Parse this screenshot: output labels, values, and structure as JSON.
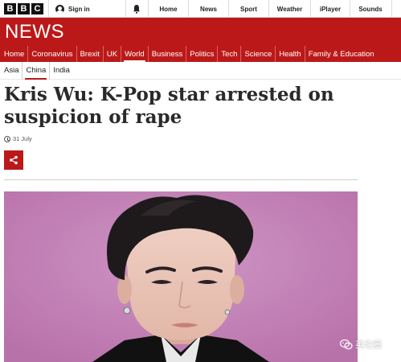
{
  "topbar": {
    "logo_letters": [
      "B",
      "B",
      "C"
    ],
    "sign_in": "Sign in",
    "nav": [
      "Home",
      "News",
      "Sport",
      "Weather",
      "iPlayer",
      "Sounds"
    ]
  },
  "banner": {
    "title": "NEWS"
  },
  "section_nav": {
    "items": [
      "Home",
      "Coronavirus",
      "Brexit",
      "UK",
      "World",
      "Business",
      "Politics",
      "Tech",
      "Science",
      "Health",
      "Family & Education"
    ],
    "active": "World"
  },
  "sub_nav": {
    "items": [
      "Asia",
      "China",
      "India"
    ],
    "active": "China"
  },
  "article": {
    "headline": "Kris Wu: K-Pop star arrested on suspicion of rape",
    "date": "31 July"
  },
  "watermark": {
    "text": "英伦圈"
  },
  "colors": {
    "brand_red": "#bb1919",
    "nav_divider": "#d56565"
  }
}
